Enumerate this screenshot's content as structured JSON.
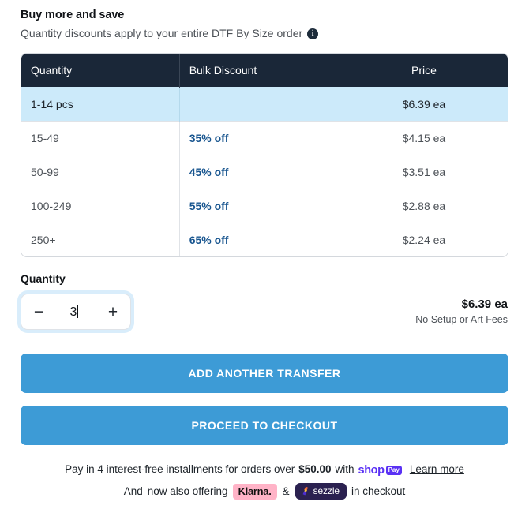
{
  "heading": {
    "title": "Buy more and save",
    "subtitle": "Quantity discounts apply to your entire DTF By Size order",
    "info_icon": "info-icon",
    "info_glyph": "i"
  },
  "tier_table": {
    "columns": [
      "Quantity",
      "Bulk Discount",
      "Price"
    ],
    "rows": [
      {
        "quantity": "1-14 pcs",
        "discount": "",
        "price": "$6.39 ea",
        "highlight": true
      },
      {
        "quantity": "15-49",
        "discount": "35% off",
        "price": "$4.15 ea",
        "highlight": false
      },
      {
        "quantity": "50-99",
        "discount": "45% off",
        "price": "$3.51 ea",
        "highlight": false
      },
      {
        "quantity": "100-249",
        "discount": "55% off",
        "price": "$2.88 ea",
        "highlight": false
      },
      {
        "quantity": "250+",
        "discount": "65% off",
        "price": "$2.24 ea",
        "highlight": false
      }
    ]
  },
  "quantity": {
    "label": "Quantity",
    "value": "3",
    "decrement_label": "−",
    "increment_label": "+"
  },
  "unit_price": {
    "amount": "$6.39 ea",
    "note": "No Setup or Art Fees"
  },
  "actions": {
    "add_another": "ADD ANOTHER TRANSFER",
    "checkout": "PROCEED TO CHECKOUT"
  },
  "payments": {
    "line1_pre": "Pay in 4 interest-free installments for orders over",
    "line1_amount": "$50.00",
    "line1_with": "with",
    "shoppay_word": "shop",
    "shoppay_badge": "Pay",
    "learn_more": "Learn more",
    "line2_and": "And",
    "line2_mid": "now also offering",
    "klarna": "Klarna.",
    "ampersand": "&",
    "sezzle": "sezzle",
    "line2_end": "in checkout"
  },
  "colors": {
    "table_header_bg": "#1a2738",
    "highlight_row_bg": "#cceafa",
    "discount_blue": "#18558f",
    "cta_blue": "#3d9bd6",
    "shoppay_purple": "#5a31f4",
    "klarna_pink": "#ffb3c7",
    "sezzle_navy": "#2b2150"
  }
}
